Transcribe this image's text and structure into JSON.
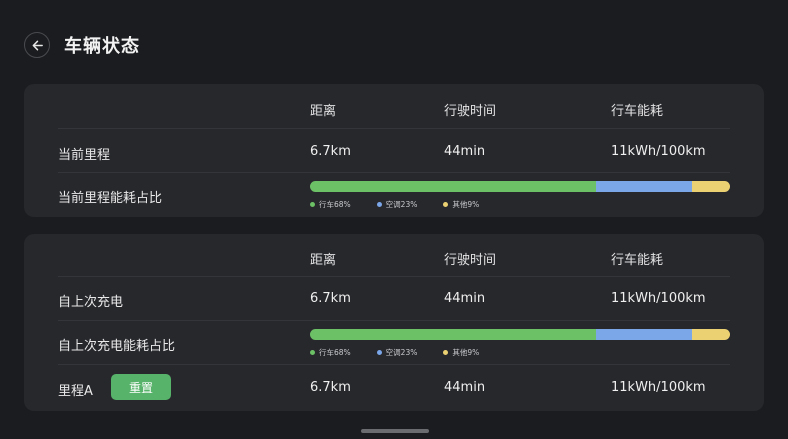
{
  "header": {
    "title": "车辆状态"
  },
  "columns": {
    "distance": "距离",
    "time": "行驶时间",
    "consumption": "行车能耗"
  },
  "colors": {
    "driving": "#6cc066",
    "ac": "#7ba6e8",
    "other": "#ecd173",
    "reset_button": "#57b36a"
  },
  "trip": {
    "label": "当前里程",
    "distance": "6.7km",
    "time": "44min",
    "consumption": "11kWh/100km",
    "share_label": "当前里程能耗占比",
    "shares": {
      "driving": 68,
      "ac": 23,
      "other": 9
    },
    "legend": {
      "driving": "行车68%",
      "ac": "空调23%",
      "other": "其他9%"
    }
  },
  "since_charge": {
    "label": "自上次充电",
    "distance": "6.7km",
    "time": "44min",
    "consumption": "11kWh/100km",
    "share_label": "自上次充电能耗占比",
    "shares": {
      "driving": 68,
      "ac": 23,
      "other": 9
    },
    "legend": {
      "driving": "行车68%",
      "ac": "空调23%",
      "other": "其他9%"
    }
  },
  "trip_a": {
    "label": "里程A",
    "reset_label": "重置",
    "distance": "6.7km",
    "time": "44min",
    "consumption": "11kWh/100km"
  }
}
